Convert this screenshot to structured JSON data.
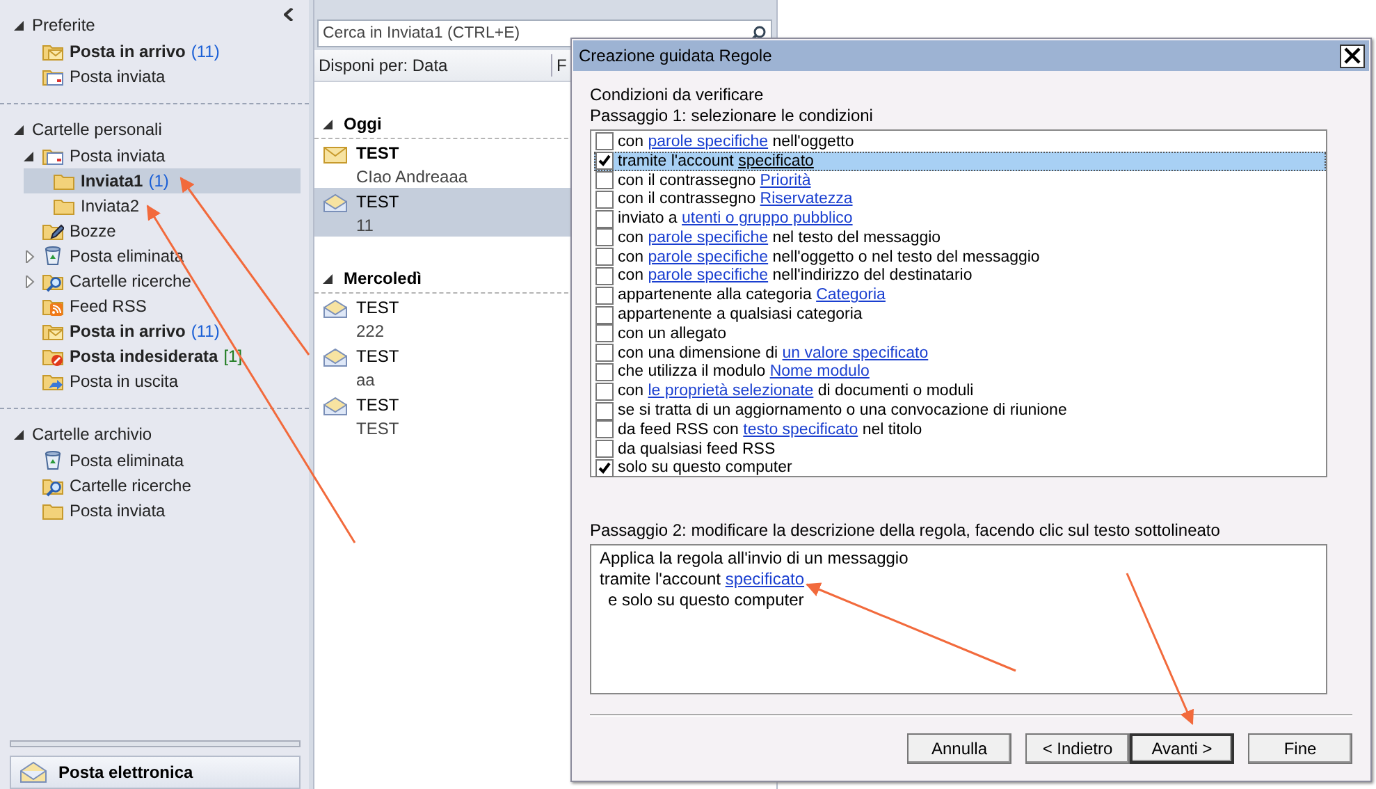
{
  "navigation": {
    "sections": [
      {
        "title": "Preferite",
        "expanded": true,
        "items": [
          {
            "label": "Posta in arrivo",
            "kind": "inbox",
            "bold": true,
            "count": "(11)",
            "selected": false
          },
          {
            "label": "Posta inviata",
            "kind": "sent",
            "bold": false,
            "selected": false
          }
        ]
      },
      {
        "title": "Cartelle personali",
        "expanded": true,
        "items": [
          {
            "label": "Posta inviata",
            "kind": "sent",
            "bold": false,
            "selected": false,
            "expanded": true,
            "children": [
              {
                "label": "Inviata1",
                "kind": "folder",
                "bold": true,
                "count": "(1)",
                "selected": true
              },
              {
                "label": "Inviata2",
                "kind": "folder",
                "bold": false,
                "selected": false
              }
            ]
          },
          {
            "label": "Bozze",
            "kind": "drafts",
            "bold": false,
            "selected": false
          },
          {
            "label": "Posta eliminata",
            "kind": "deleted",
            "bold": false,
            "selected": false,
            "expanded": false
          },
          {
            "label": "Cartelle ricerche",
            "kind": "search",
            "bold": false,
            "selected": false,
            "expanded": false
          },
          {
            "label": "Feed RSS",
            "kind": "rss",
            "bold": false,
            "selected": false
          },
          {
            "label": "Posta in arrivo",
            "kind": "inbox",
            "bold": true,
            "count": "(11)",
            "selected": false
          },
          {
            "label": "Posta indesiderata",
            "kind": "junk",
            "bold": true,
            "count": "[1]",
            "selected": false
          },
          {
            "label": "Posta in uscita",
            "kind": "outbox",
            "bold": false,
            "selected": false
          }
        ]
      },
      {
        "title": "Cartelle archivio",
        "expanded": true,
        "items": [
          {
            "label": "Posta eliminata",
            "kind": "deleted",
            "bold": false,
            "selected": false
          },
          {
            "label": "Cartelle ricerche",
            "kind": "search",
            "bold": false,
            "selected": false
          },
          {
            "label": "Posta inviata",
            "kind": "folder",
            "bold": false,
            "selected": false
          }
        ]
      }
    ],
    "bottom_button": {
      "label": "Posta elettronica"
    }
  },
  "message_list": {
    "search": {
      "placeholder": "Cerca in Inviata1 (CTRL+E)"
    },
    "arrange_by": "Disponi per: Data",
    "column_2": "F",
    "groups": [
      {
        "title": "Oggi",
        "expanded": true,
        "messages": [
          {
            "subject": "TEST",
            "preview": "CIao Andreaaa",
            "unread": true,
            "selected": false
          },
          {
            "subject": "TEST",
            "preview": "11",
            "unread": false,
            "selected": true
          }
        ]
      },
      {
        "title": "Mercoledì",
        "expanded": true,
        "messages": [
          {
            "subject": "TEST",
            "preview": "222",
            "unread": false,
            "selected": false
          },
          {
            "subject": "TEST",
            "preview": "aa",
            "unread": false,
            "selected": false
          },
          {
            "subject": "TEST",
            "preview": "TEST",
            "unread": false,
            "selected": false
          }
        ]
      }
    ]
  },
  "dialog": {
    "title": "Creazione guidata Regole",
    "section": "Condizioni da verificare",
    "step1": "Passaggio 1: selezionare le condizioni",
    "conditions": [
      {
        "checked": false,
        "selected": false,
        "segments": [
          {
            "text": "con "
          },
          {
            "text": "parole specifiche",
            "link": true
          },
          {
            "text": " nell'oggetto"
          }
        ]
      },
      {
        "checked": true,
        "selected": true,
        "segments": [
          {
            "text": "tramite l'account "
          },
          {
            "text": "specificato",
            "link": true
          }
        ]
      },
      {
        "checked": false,
        "selected": false,
        "segments": [
          {
            "text": "con il contrassegno "
          },
          {
            "text": "Priorità",
            "link": true
          }
        ]
      },
      {
        "checked": false,
        "selected": false,
        "segments": [
          {
            "text": "con il contrassegno "
          },
          {
            "text": "Riservatezza",
            "link": true
          }
        ]
      },
      {
        "checked": false,
        "selected": false,
        "segments": [
          {
            "text": "inviato a "
          },
          {
            "text": "utenti o gruppo pubblico",
            "link": true
          }
        ]
      },
      {
        "checked": false,
        "selected": false,
        "segments": [
          {
            "text": "con "
          },
          {
            "text": "parole specifiche",
            "link": true
          },
          {
            "text": " nel testo del messaggio"
          }
        ]
      },
      {
        "checked": false,
        "selected": false,
        "segments": [
          {
            "text": "con "
          },
          {
            "text": "parole specifiche",
            "link": true
          },
          {
            "text": " nell'oggetto o nel testo del messaggio"
          }
        ]
      },
      {
        "checked": false,
        "selected": false,
        "segments": [
          {
            "text": "con "
          },
          {
            "text": "parole specifiche",
            "link": true
          },
          {
            "text": " nell'indirizzo del destinatario"
          }
        ]
      },
      {
        "checked": false,
        "selected": false,
        "segments": [
          {
            "text": "appartenente alla categoria "
          },
          {
            "text": "Categoria",
            "link": true
          }
        ]
      },
      {
        "checked": false,
        "selected": false,
        "segments": [
          {
            "text": "appartenente a qualsiasi categoria"
          }
        ]
      },
      {
        "checked": false,
        "selected": false,
        "segments": [
          {
            "text": "con un allegato"
          }
        ]
      },
      {
        "checked": false,
        "selected": false,
        "segments": [
          {
            "text": "con una dimensione di "
          },
          {
            "text": "un valore specificato",
            "link": true
          }
        ]
      },
      {
        "checked": false,
        "selected": false,
        "segments": [
          {
            "text": "che utilizza il modulo "
          },
          {
            "text": "Nome modulo",
            "link": true
          }
        ]
      },
      {
        "checked": false,
        "selected": false,
        "segments": [
          {
            "text": "con "
          },
          {
            "text": "le proprietà selezionate",
            "link": true
          },
          {
            "text": " di documenti o moduli"
          }
        ]
      },
      {
        "checked": false,
        "selected": false,
        "segments": [
          {
            "text": "se si tratta di un aggiornamento o una convocazione di riunione"
          }
        ]
      },
      {
        "checked": false,
        "selected": false,
        "segments": [
          {
            "text": "da feed RSS con "
          },
          {
            "text": "testo specificato",
            "link": true
          },
          {
            "text": " nel titolo"
          }
        ]
      },
      {
        "checked": false,
        "selected": false,
        "segments": [
          {
            "text": "da qualsiasi feed RSS"
          }
        ]
      },
      {
        "checked": true,
        "selected": false,
        "segments": [
          {
            "text": "solo su questo computer"
          }
        ]
      }
    ],
    "step2": "Passaggio 2: modificare la descrizione della regola, facendo clic sul testo sottolineato",
    "description": [
      {
        "indent": false,
        "segments": [
          {
            "text": "Applica la regola all'invio di un messaggio"
          }
        ]
      },
      {
        "indent": false,
        "segments": [
          {
            "text": "tramite l'account "
          },
          {
            "text": "specificato",
            "link": true
          }
        ]
      },
      {
        "indent": true,
        "segments": [
          {
            "text": "e solo su questo computer"
          }
        ]
      }
    ],
    "buttons": [
      {
        "label": "Annulla",
        "default": false
      },
      {
        "label": "< Indietro",
        "default": false
      },
      {
        "label": "Avanti >",
        "default": true
      },
      {
        "label": "Fine",
        "default": false
      }
    ]
  }
}
